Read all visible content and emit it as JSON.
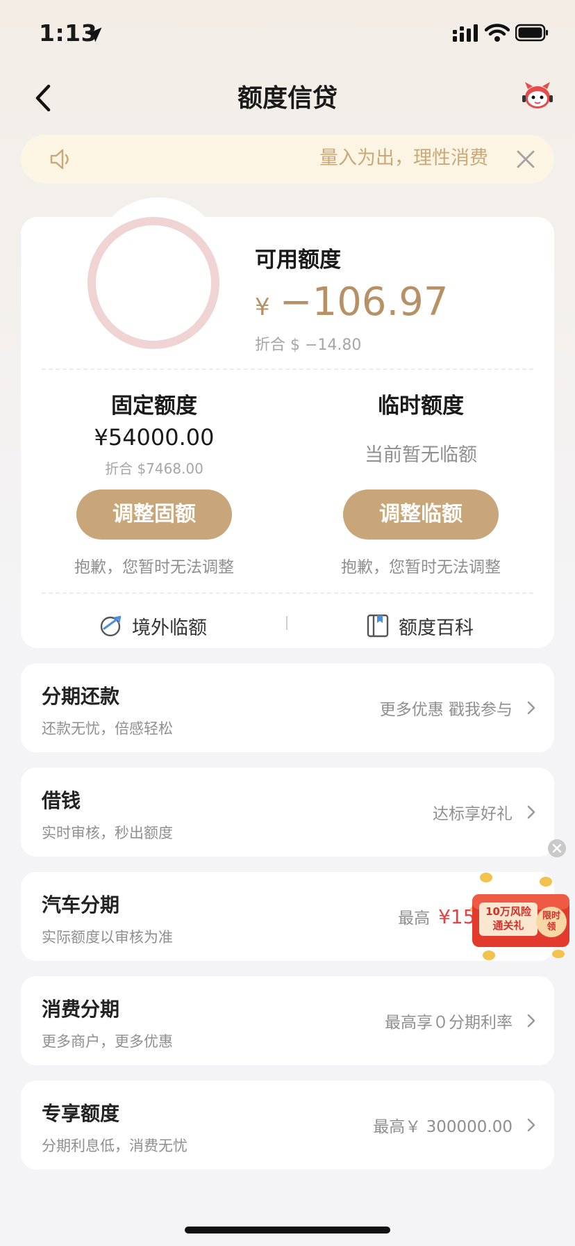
{
  "status_bar": {
    "time": "1:13"
  },
  "nav": {
    "title": "额度信贷"
  },
  "notice": {
    "text": "量入为出，理性消费"
  },
  "credit": {
    "available_label": "可用额度",
    "available_currency": "¥",
    "available_amount": "−106.97",
    "available_converted": "折合 $ −14.80",
    "fixed": {
      "title": "固定额度",
      "amount": "¥54000.00",
      "converted": "折合 $7468.00",
      "button": "调整固额",
      "hint": "抱歉，您暂时无法调整"
    },
    "temporary": {
      "title": "临时额度",
      "empty_text": "当前暂无临额",
      "button": "调整临额",
      "hint": "抱歉，您暂时无法调整"
    },
    "links": {
      "overseas": "境外临额",
      "wiki": "额度百科"
    }
  },
  "items": [
    {
      "title": "分期还款",
      "subtitle": "还款无忧，倍感轻松",
      "right": "更多优惠 戳我参与"
    },
    {
      "title": "借钱",
      "subtitle": "实时审核，秒出额度",
      "right": "达标享好礼"
    },
    {
      "title": "汽车分期",
      "subtitle": "实际额度以审核为准",
      "right_prefix": "最高",
      "right_highlight": "¥15000"
    },
    {
      "title": "消费分期",
      "subtitle": "更多商户，更多优惠",
      "right": "最高享０分期利率"
    },
    {
      "title": "专享额度",
      "subtitle": "分期利息低，消费无忧",
      "right": "最高￥ 300000.00"
    }
  ],
  "promo": {
    "line1": "10万风险",
    "line2": "通关礼",
    "badge": "限时领"
  },
  "colors": {
    "accent": "#c8a679",
    "amount": "#b89066",
    "highlight": "#e54343",
    "ring": "#f0d4d4"
  }
}
